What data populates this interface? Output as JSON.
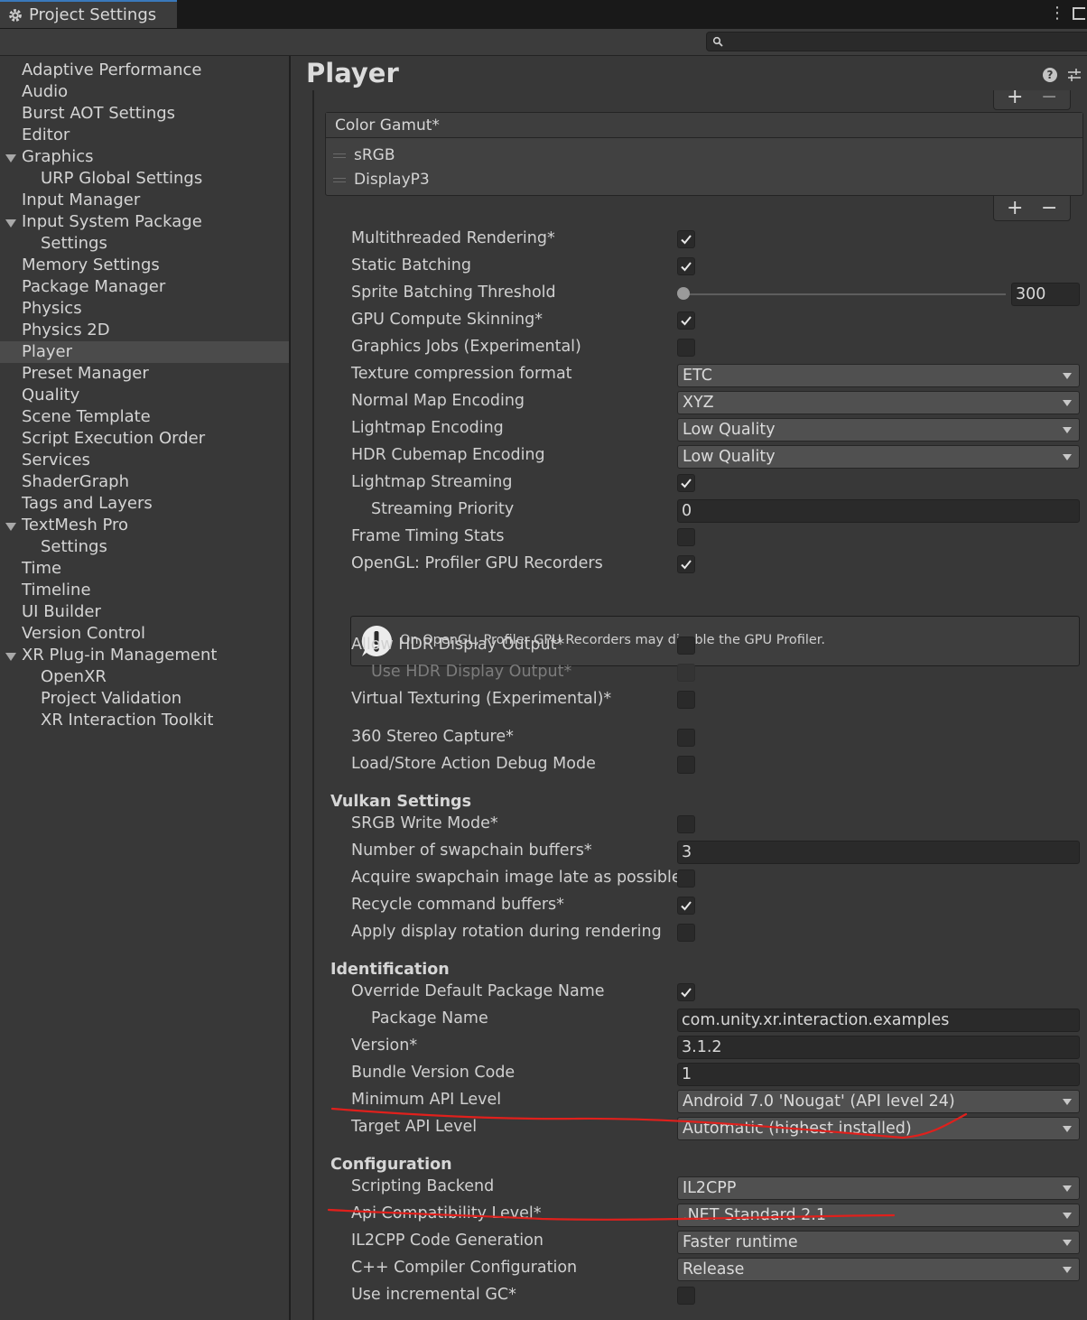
{
  "window": {
    "tab_title": "Project Settings"
  },
  "search": {
    "placeholder": ""
  },
  "sidebar": {
    "items": [
      {
        "label": "Adaptive Performance"
      },
      {
        "label": "Audio"
      },
      {
        "label": "Burst AOT Settings"
      },
      {
        "label": "Editor"
      },
      {
        "label": "Graphics",
        "expanded": true
      },
      {
        "label": "URP Global Settings",
        "child": true
      },
      {
        "label": "Input Manager"
      },
      {
        "label": "Input System Package",
        "expanded": true
      },
      {
        "label": "Settings",
        "child": true
      },
      {
        "label": "Memory Settings"
      },
      {
        "label": "Package Manager"
      },
      {
        "label": "Physics"
      },
      {
        "label": "Physics 2D"
      },
      {
        "label": "Player",
        "selected": true
      },
      {
        "label": "Preset Manager"
      },
      {
        "label": "Quality"
      },
      {
        "label": "Scene Template"
      },
      {
        "label": "Script Execution Order"
      },
      {
        "label": "Services"
      },
      {
        "label": "ShaderGraph"
      },
      {
        "label": "Tags and Layers"
      },
      {
        "label": "TextMesh Pro",
        "expanded": true
      },
      {
        "label": "Settings",
        "child": true
      },
      {
        "label": "Time"
      },
      {
        "label": "Timeline"
      },
      {
        "label": "UI Builder"
      },
      {
        "label": "Version Control"
      },
      {
        "label": "XR Plug-in Management",
        "expanded": true
      },
      {
        "label": "OpenXR",
        "child": true
      },
      {
        "label": "Project Validation",
        "child": true
      },
      {
        "label": "XR Interaction Toolkit",
        "child": true
      }
    ]
  },
  "main": {
    "title": "Player",
    "color_gamut": {
      "header": "Color Gamut*",
      "items": [
        "sRGB",
        "DisplayP3"
      ],
      "plus": "+",
      "minus": "−"
    },
    "settings": [
      {
        "label": "Multithreaded Rendering*",
        "control": "checkbox",
        "checked": true
      },
      {
        "label": "Static Batching",
        "control": "checkbox",
        "checked": true
      },
      {
        "label": "Sprite Batching Threshold",
        "control": "slider",
        "value": "300"
      },
      {
        "label": "GPU Compute Skinning*",
        "control": "checkbox",
        "checked": true
      },
      {
        "label": "Graphics Jobs (Experimental)",
        "control": "checkbox",
        "checked": false
      },
      {
        "label": "Texture compression format",
        "control": "dropdown",
        "value": "ETC"
      },
      {
        "label": "Normal Map Encoding",
        "control": "dropdown",
        "value": "XYZ"
      },
      {
        "label": "Lightmap Encoding",
        "control": "dropdown",
        "value": "Low Quality"
      },
      {
        "label": "HDR Cubemap Encoding",
        "control": "dropdown",
        "value": "Low Quality"
      },
      {
        "label": "Lightmap Streaming",
        "control": "checkbox",
        "checked": true
      },
      {
        "label": "Streaming Priority",
        "control": "text",
        "value": "0",
        "indent": true
      },
      {
        "label": "Frame Timing Stats",
        "control": "checkbox",
        "checked": false
      },
      {
        "label": "OpenGL: Profiler GPU Recorders",
        "control": "checkbox",
        "checked": true
      },
      {
        "label": "Allow HDR Display Output*",
        "control": "checkbox",
        "checked": false
      },
      {
        "label": "Use HDR Display Output*",
        "control": "checkbox",
        "checked": false,
        "indent": true,
        "disabled": true
      },
      {
        "label": "Virtual Texturing (Experimental)*",
        "control": "checkbox",
        "checked": false
      },
      {
        "label": "360 Stereo Capture*",
        "control": "checkbox",
        "checked": false
      },
      {
        "label": "Load/Store Action Debug Mode",
        "control": "checkbox",
        "checked": false
      },
      {
        "label": "SRGB Write Mode*",
        "control": "checkbox",
        "checked": false
      },
      {
        "label": "Number of swapchain buffers*",
        "control": "text",
        "value": "3"
      },
      {
        "label": "Acquire swapchain image late as possible",
        "control": "checkbox",
        "checked": false
      },
      {
        "label": "Recycle command buffers*",
        "control": "checkbox",
        "checked": true
      },
      {
        "label": "Apply display rotation during rendering",
        "control": "checkbox",
        "checked": false
      },
      {
        "label": "Override Default Package Name",
        "control": "checkbox",
        "checked": true
      },
      {
        "label": "Package Name",
        "control": "text",
        "value": "com.unity.xr.interaction.examples",
        "indent": true
      },
      {
        "label": "Version*",
        "control": "text",
        "value": "3.1.2"
      },
      {
        "label": "Bundle Version Code",
        "control": "text",
        "value": "1"
      },
      {
        "label": "Minimum API Level",
        "control": "dropdown",
        "value": "Android 7.0 'Nougat' (API level 24)"
      },
      {
        "label": "Target API Level",
        "control": "dropdown",
        "value": "Automatic (highest installed)"
      },
      {
        "label": "Scripting Backend",
        "control": "dropdown",
        "value": "IL2CPP"
      },
      {
        "label": "Api Compatibility Level*",
        "control": "dropdown",
        "value": ".NET Standard 2.1"
      },
      {
        "label": "IL2CPP Code Generation",
        "control": "dropdown",
        "value": "Faster runtime"
      },
      {
        "label": "C++ Compiler Configuration",
        "control": "dropdown",
        "value": "Release"
      },
      {
        "label": "Use incremental GC*",
        "control": "checkbox",
        "checked": false
      }
    ],
    "sections": {
      "vulkan": "Vulkan Settings",
      "identification": "Identification",
      "configuration": "Configuration"
    },
    "help_box": {
      "text": "On OpenGL, Profiler GPU Recorders may disable the GPU Profiler.",
      "icon": "warning-icon"
    }
  },
  "colors": {
    "accent": "#3a79bb",
    "annotation": "#e0201c"
  }
}
